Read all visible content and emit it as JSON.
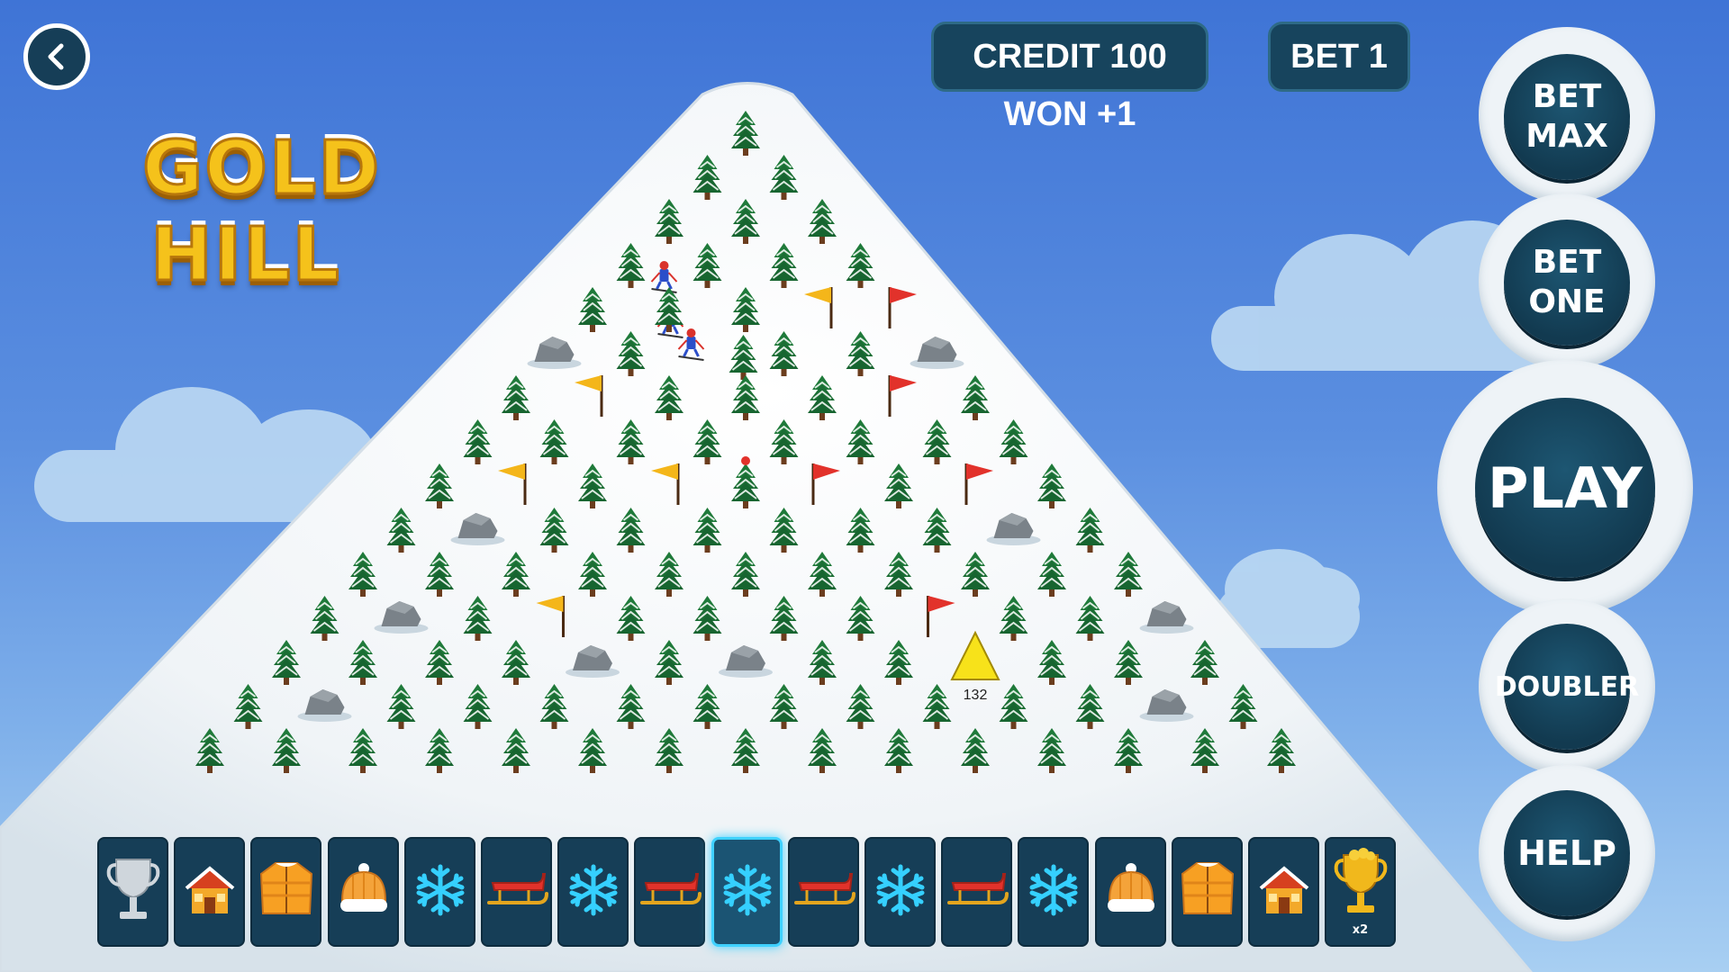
{
  "game": {
    "logo_line1": "GOLD",
    "logo_line2": "HILL"
  },
  "header": {
    "credit_text": "CREDIT 100",
    "bet_text": "BET 1",
    "won_text": "WON +1"
  },
  "buttons": {
    "bet_max": "BET\nMAX",
    "bet_one": "BET\nONE",
    "play": "PLAY",
    "doubler": "DOUBLER",
    "help": "HELP"
  },
  "board": {
    "marker_value": "132"
  },
  "prize_tiles": [
    {
      "icon": "silver-trophy-icon",
      "label": ""
    },
    {
      "icon": "house-icon",
      "label": ""
    },
    {
      "icon": "jacket-icon",
      "label": ""
    },
    {
      "icon": "beanie-icon",
      "label": ""
    },
    {
      "icon": "snowflake-icon",
      "label": ""
    },
    {
      "icon": "sled-icon",
      "label": ""
    },
    {
      "icon": "snowflake-icon",
      "label": ""
    },
    {
      "icon": "sled-icon",
      "label": ""
    },
    {
      "icon": "snowflake-icon",
      "label": "",
      "highlighted": true
    },
    {
      "icon": "sled-icon",
      "label": ""
    },
    {
      "icon": "snowflake-icon",
      "label": ""
    },
    {
      "icon": "sled-icon",
      "label": ""
    },
    {
      "icon": "snowflake-icon",
      "label": ""
    },
    {
      "icon": "beanie-icon",
      "label": ""
    },
    {
      "icon": "jacket-icon",
      "label": ""
    },
    {
      "icon": "house-icon",
      "label": ""
    },
    {
      "icon": "gold-trophy-icon",
      "label": "x2"
    }
  ],
  "colors": {
    "panel_dark": "#163e57",
    "highlight": "#3fd1ff",
    "flag_yellow": "#f4b61a",
    "flag_red": "#e2322b",
    "marker_yellow": "#f7e21a"
  }
}
